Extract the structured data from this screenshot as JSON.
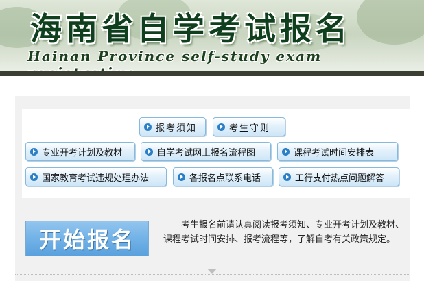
{
  "header": {
    "title": "海南省自学考试报名",
    "subtitle": "Hainan Province self-study exam registration"
  },
  "nav": {
    "row1": [
      "报考须知",
      "考生守则"
    ],
    "row2": [
      "专业开考计划及教材",
      "自学考试网上报名流程图",
      "课程考试时间安排表"
    ],
    "row3": [
      "国家教育考试违规处理办法",
      "各报名点联系电话",
      "工行支付热点问题解答"
    ]
  },
  "start_button": "开始报名",
  "notice": "考生报名前请认真阅读报考须知、专业开考计划及教材、课程考试时间安排、报考流程等，了解自考有关政策规定。",
  "icons": [
    "arrow-circle-icon",
    "down-arrow-icon"
  ]
}
